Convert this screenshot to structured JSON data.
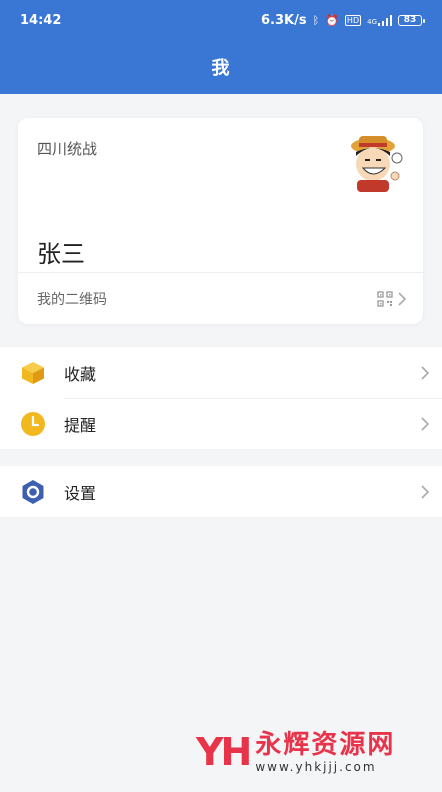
{
  "status_bar": {
    "time": "14:42",
    "network_speed": "6.3K/s",
    "icons": [
      "bluetooth-icon",
      "alarm-icon",
      "hd-icon",
      "signal-4g-icon"
    ],
    "signal_label": "4G",
    "battery_level": "83"
  },
  "header": {
    "title": "我",
    "background": "#3a76d4"
  },
  "profile": {
    "organization": "四川统战",
    "name": "张三",
    "qr_label": "我的二维码",
    "avatar_icon": "avatar-cartoon-icon"
  },
  "menu": {
    "group1": [
      {
        "label": "收藏",
        "icon": "favorites-box-icon",
        "color": "#f2b81f"
      },
      {
        "label": "提醒",
        "icon": "clock-icon",
        "color": "#f2b81f"
      }
    ],
    "group2": [
      {
        "label": "设置",
        "icon": "settings-hexagon-icon",
        "color": "#3d5fb0"
      }
    ]
  },
  "watermark": {
    "logo": "YH",
    "name": "永辉资源网",
    "url": "www.yhkjjj.com"
  }
}
